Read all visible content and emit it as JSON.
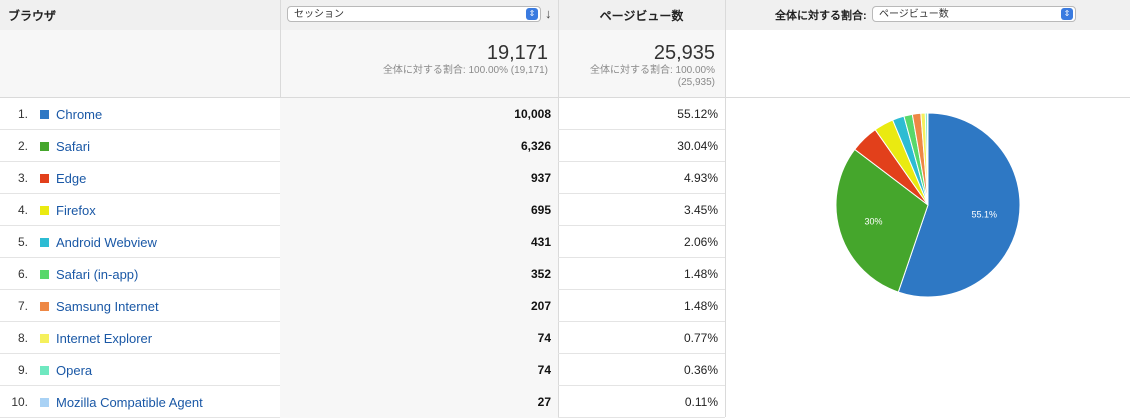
{
  "header": {
    "dimension_label": "ブラウザ",
    "metric_select_value": "セッション",
    "pageviews_label": "ページビュー数",
    "share_label": "全体に対する割合:",
    "share_select_value": "ページビュー数",
    "sort_icon": "arrow-down-icon",
    "select_arrow_icon": "updown-chevron-icon"
  },
  "totals": {
    "sessions_value": "19,171",
    "sessions_sub": "全体に対する割合: 100.00% (19,171)",
    "pageviews_value": "25,935",
    "pageviews_sub1": "全体に対する割合: 100.00%",
    "pageviews_sub2": "(25,935)"
  },
  "rows": [
    {
      "rank": "1.",
      "name": "Chrome",
      "color": "#2e78c4",
      "sessions": "10,008",
      "pageviews_pct": "55.12%"
    },
    {
      "rank": "2.",
      "name": "Safari",
      "color": "#45a62c",
      "sessions": "6,326",
      "pageviews_pct": "30.04%"
    },
    {
      "rank": "3.",
      "name": "Edge",
      "color": "#e2401b",
      "sessions": "937",
      "pageviews_pct": "4.93%"
    },
    {
      "rank": "4.",
      "name": "Firefox",
      "color": "#eaea11",
      "sessions": "695",
      "pageviews_pct": "3.45%"
    },
    {
      "rank": "5.",
      "name": "Android Webview",
      "color": "#2dbcd3",
      "sessions": "431",
      "pageviews_pct": "2.06%"
    },
    {
      "rank": "6.",
      "name": "Safari (in-app)",
      "color": "#58d86a",
      "sessions": "352",
      "pageviews_pct": "1.48%"
    },
    {
      "rank": "7.",
      "name": "Samsung Internet",
      "color": "#ee8845",
      "sessions": "207",
      "pageviews_pct": "1.48%"
    },
    {
      "rank": "8.",
      "name": "Internet Explorer",
      "color": "#f5f05c",
      "sessions": "74",
      "pageviews_pct": "0.77%"
    },
    {
      "rank": "9.",
      "name": "Opera",
      "color": "#6fe8c0",
      "sessions": "74",
      "pageviews_pct": "0.36%"
    },
    {
      "rank": "10.",
      "name": "Mozilla Compatible Agent",
      "color": "#a9d2f5",
      "sessions": "27",
      "pageviews_pct": "0.11%"
    }
  ],
  "chart_data": {
    "type": "pie",
    "categories": [
      "Chrome",
      "Safari",
      "Edge",
      "Firefox",
      "Android Webview",
      "Safari (in-app)",
      "Samsung Internet",
      "Internet Explorer",
      "Opera",
      "Mozilla Compatible Agent"
    ],
    "values": [
      55.12,
      30.04,
      4.93,
      3.45,
      2.06,
      1.48,
      1.48,
      0.77,
      0.36,
      0.11
    ],
    "colors": [
      "#2e78c4",
      "#45a62c",
      "#e2401b",
      "#eaea11",
      "#2dbcd3",
      "#58d86a",
      "#ee8845",
      "#f5f05c",
      "#6fe8c0",
      "#a9d2f5"
    ],
    "slice_labels": [
      "55.1%",
      "30%"
    ]
  }
}
